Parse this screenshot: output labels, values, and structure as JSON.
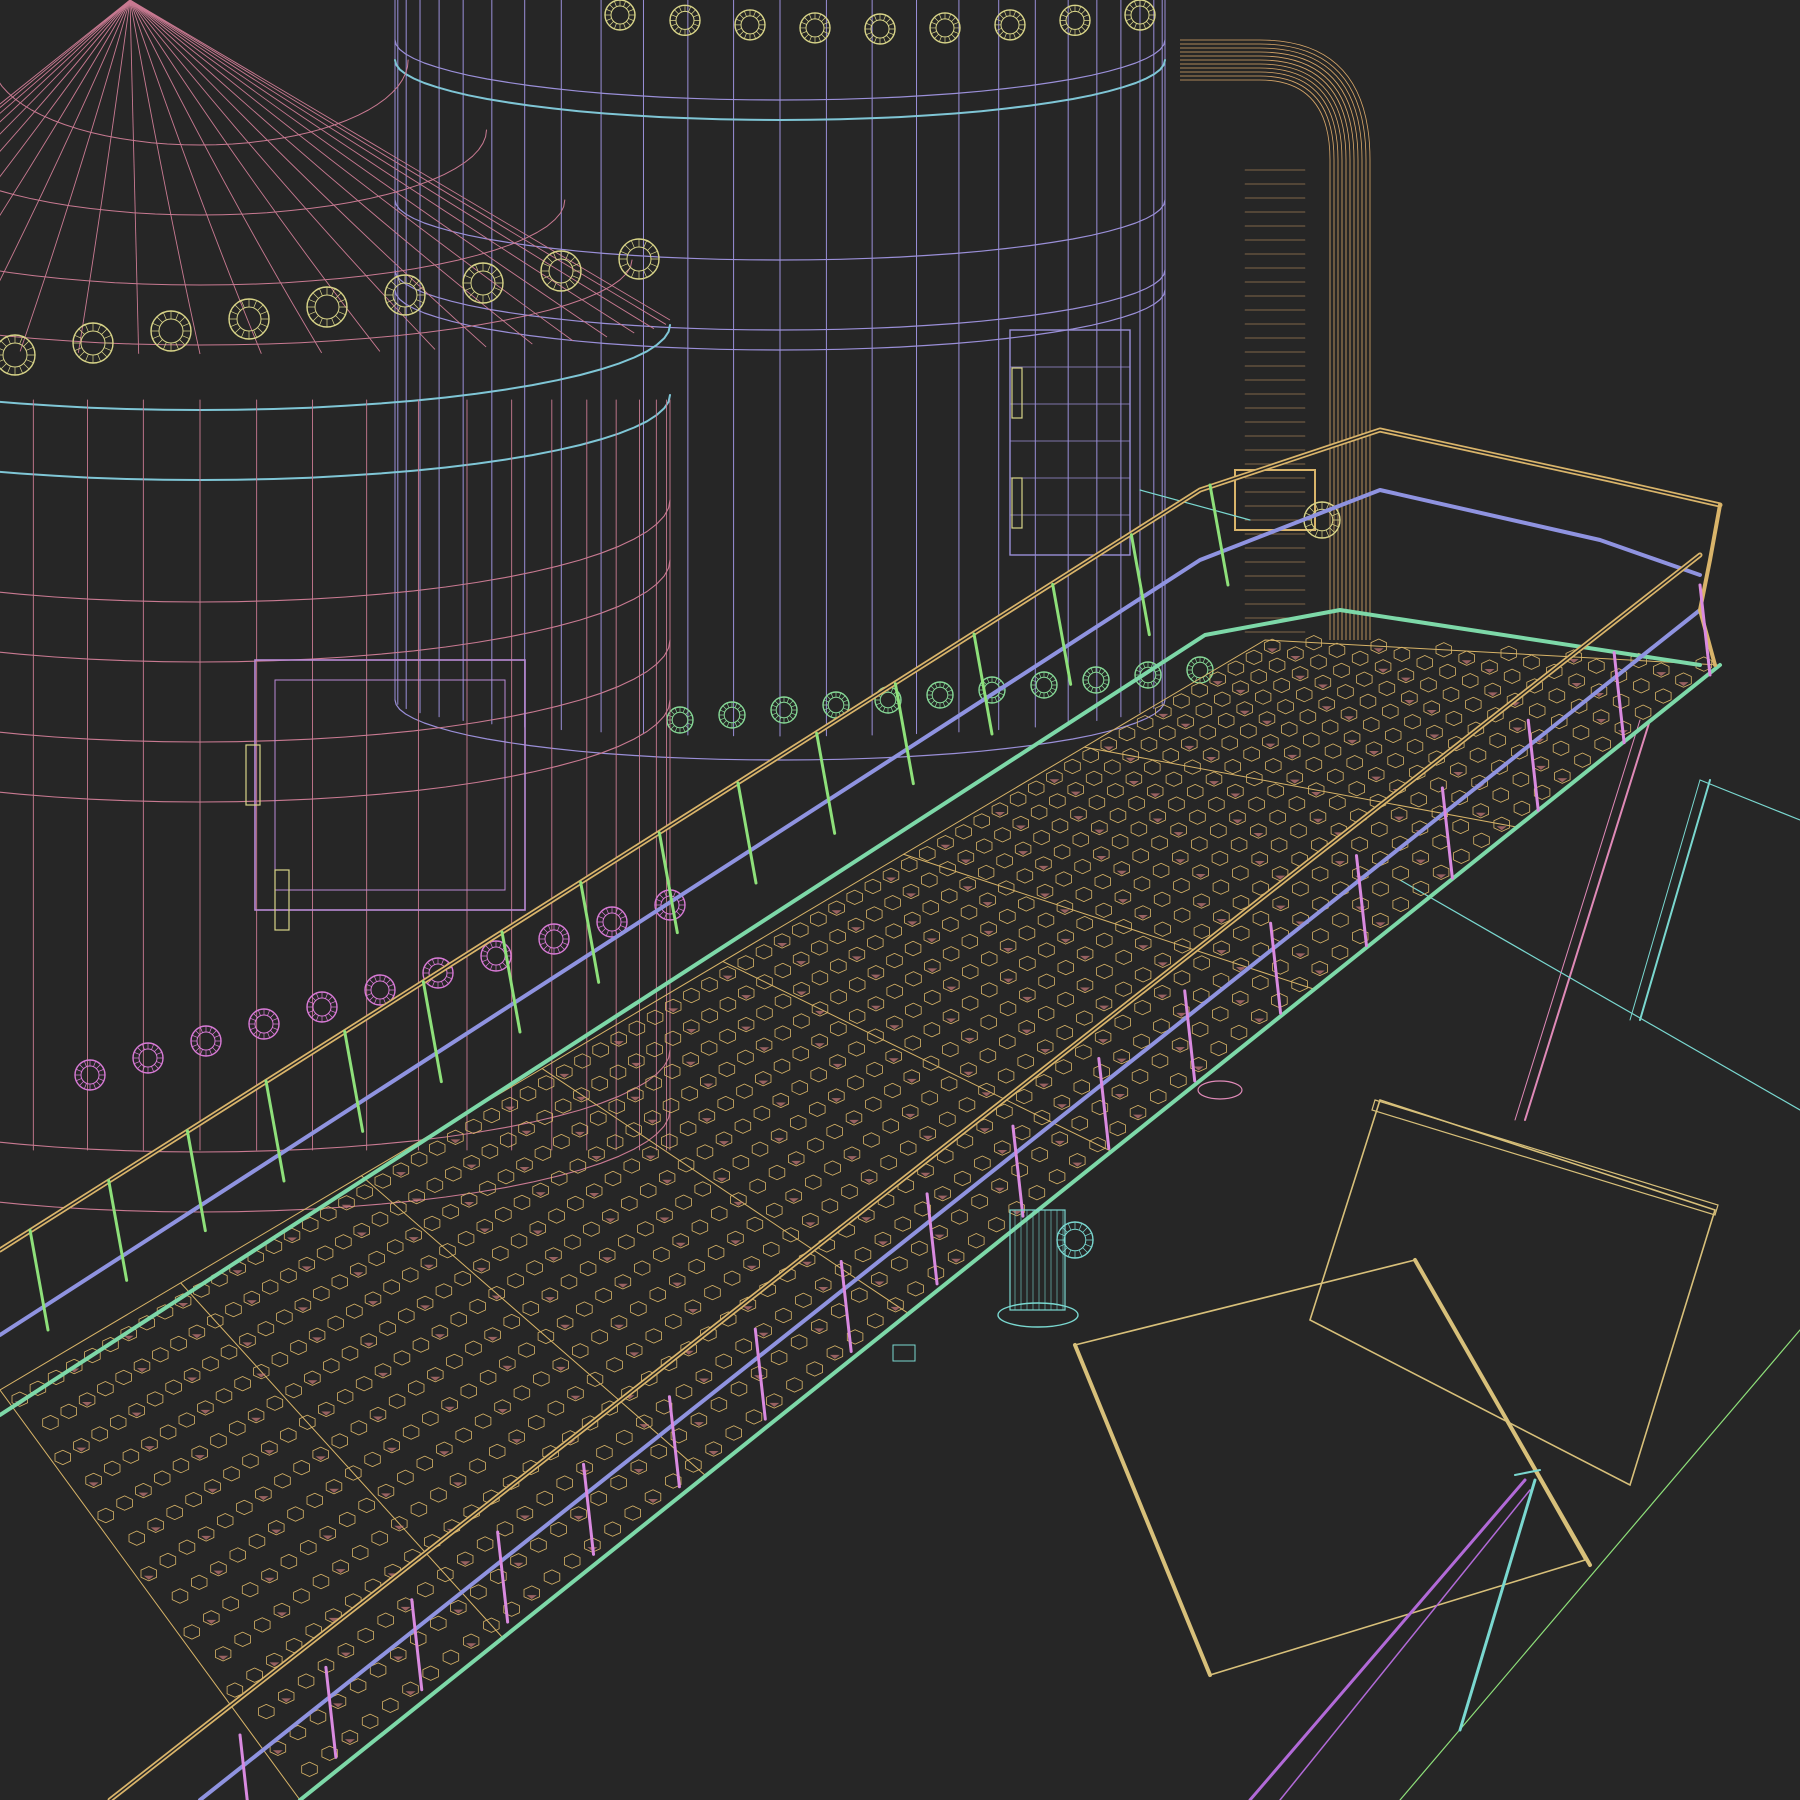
{
  "scene": {
    "render_mode": "wireframe",
    "background": "#262626",
    "palette": {
      "tank_left": "#c97a92",
      "tank_right": "#9a8fd8",
      "tank_band_cyan": "#7fc6d6",
      "tank_band_purple": "#b98ad6",
      "bolt_yellow": "#d8d488",
      "bolt_green": "#86d896",
      "bolt_magenta": "#d87ad6",
      "pipe": "#d9a86a",
      "rail_top": "#d9b46a",
      "rail_mid": "#8f93e0",
      "rail_bottom": "#7dd8a8",
      "post_green": "#8ee07a",
      "post_magenta": "#d98ae0",
      "grating": "#d8b468",
      "grating_fill": "#c97a7a",
      "support_pink": "#e08ab8",
      "support_cyan": "#7ad8d0",
      "panel": "#d8c07a",
      "ladder": "#b26ad8"
    },
    "objects": [
      {
        "name": "storage-tank-left",
        "icon": "tank-icon"
      },
      {
        "name": "storage-tank-right",
        "icon": "tank-icon"
      },
      {
        "name": "elbow-pipe",
        "icon": "pipe-icon"
      },
      {
        "name": "catwalk-grating",
        "icon": "grating-icon"
      },
      {
        "name": "guard-railing",
        "icon": "railing-icon"
      },
      {
        "name": "support-columns",
        "icon": "column-icon"
      },
      {
        "name": "leaning-panels",
        "icon": "panel-icon"
      },
      {
        "name": "ladder",
        "icon": "ladder-icon"
      },
      {
        "name": "flanged-valve",
        "icon": "valve-icon"
      }
    ]
  }
}
